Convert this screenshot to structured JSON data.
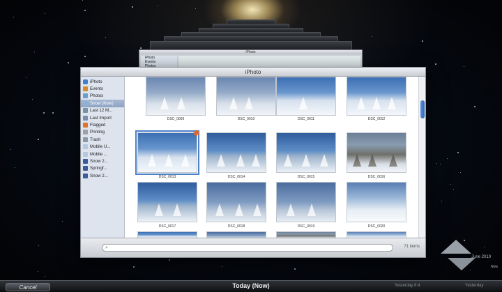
{
  "app": {
    "window_title": "iPhoto",
    "back_window_title": "iPhoto",
    "back_window_sidebar": [
      "iPhoto",
      "Events",
      "Photos"
    ]
  },
  "sidebar": {
    "items": [
      {
        "label": "iPhoto",
        "icon": "iphoto-icon",
        "selected": false
      },
      {
        "label": "Events",
        "icon": "events-icon",
        "selected": false
      },
      {
        "label": "Photos",
        "icon": "photos-icon",
        "selected": false
      },
      {
        "label": "Snow (Now)",
        "icon": "album-icon",
        "selected": true
      },
      {
        "label": "Last 12 M...",
        "icon": "calendar-icon",
        "selected": false
      },
      {
        "label": "Last Import",
        "icon": "import-icon",
        "selected": false
      },
      {
        "label": "Flagged",
        "icon": "flag-icon",
        "selected": false
      },
      {
        "label": "Printing",
        "icon": "print-icon",
        "selected": false
      },
      {
        "label": "Trash",
        "icon": "trash-icon",
        "selected": false
      },
      {
        "label": "Mobile U...",
        "icon": "mobileme-icon",
        "selected": false
      },
      {
        "label": "Mobile ...",
        "icon": "mobileme-icon",
        "selected": false
      },
      {
        "label": "Snow 2...",
        "icon": "facebook-icon",
        "selected": false
      },
      {
        "label": "Springf...",
        "icon": "facebook-icon",
        "selected": false
      },
      {
        "label": "Snow 2...",
        "icon": "facebook-icon",
        "selected": false
      }
    ]
  },
  "photos": [
    {
      "label": "DSC_0009"
    },
    {
      "label": "DSC_0010"
    },
    {
      "label": "DSC_0011"
    },
    {
      "label": "DSC_0012"
    },
    {
      "label": "DSC_0013"
    },
    {
      "label": "DSC_0014"
    },
    {
      "label": "DSC_0015"
    },
    {
      "label": "DSC_0016"
    },
    {
      "label": "DSC_0017"
    },
    {
      "label": "DSC_0018"
    },
    {
      "label": "DSC_0019"
    },
    {
      "label": "DSC_0020"
    }
  ],
  "bottom_bar": {
    "search_placeholder": "",
    "item_count": "71 items"
  },
  "time_machine": {
    "cancel_label": "Cancel",
    "current_label": "Today (Now)",
    "timeline_tick_1": "Yesterday 8:4",
    "timeline_tick_2": "Yesterday",
    "timeline_date": "June 2010",
    "timeline_now": "Now"
  },
  "colors": {
    "selection": "#4c80c8",
    "sidebar_bg": "#dde4ee",
    "accent_badge": "#e0682a"
  }
}
